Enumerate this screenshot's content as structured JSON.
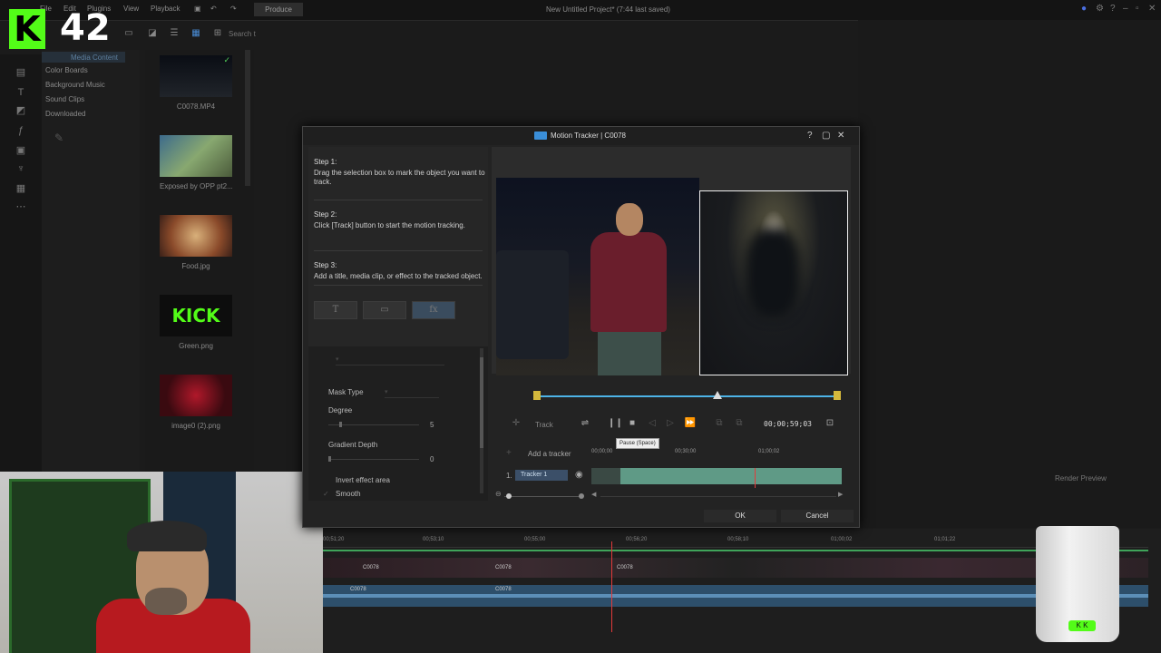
{
  "menubar": {
    "items": [
      "File",
      "Edit",
      "Plugins",
      "View",
      "Playback"
    ],
    "produce_label": "Produce",
    "project_title": "New Untitled Project* (7:44 last saved)"
  },
  "overlay": {
    "kick_badge": "K",
    "kick_count": "42"
  },
  "media_toolbar": {
    "search_placeholder": "Search t"
  },
  "library_tree": {
    "items": [
      "Media Content",
      "Color Boards",
      "Background Music",
      "Sound Clips",
      "Downloaded"
    ]
  },
  "media_items": [
    {
      "label": "C0078.MP4"
    },
    {
      "label": "Exposed by OPP pt2...."
    },
    {
      "label": "Food.jpg"
    },
    {
      "label": "Green.png",
      "thumb_text": "KICK"
    },
    {
      "label": "image0 (2).png"
    }
  ],
  "dialog": {
    "title": "Motion Tracker | C0078",
    "step1_title": "Step 1:",
    "step1_text": "Drag the selection box to mark the object you want to track.",
    "step2_title": "Step 2:",
    "step2_text": "Click [Track] button to start the motion tracking.",
    "step3_title": "Step 3:",
    "step3_text": "Add a title, media clip, or effect to the tracked object.",
    "tool_title": "T",
    "tool_fx": "fx",
    "props": {
      "mask_type_label": "Mask Type",
      "degree_label": "Degree",
      "degree_value": "5",
      "gradient_label": "Gradient Depth",
      "gradient_value": "0",
      "invert_label": "Invert effect area",
      "smooth_label": "Smooth"
    },
    "track_label": "Track",
    "timecode": "00;00;59;03",
    "tooltip": "Pause (Space)",
    "add_tracker_label": "Add a tracker",
    "ruler": [
      "00;00;00",
      "00;30;00",
      "01;00;02"
    ],
    "tracker_number": "1.",
    "tracker_name": "Tracker 1",
    "ok_label": "OK",
    "cancel_label": "Cancel"
  },
  "render_preview": "Render Preview",
  "timeline": {
    "ticks": [
      "00;51;20",
      "00;53;10",
      "00;55;00",
      "00;56;20",
      "00;58;10",
      "01;00;02",
      "01;01;22"
    ],
    "clip_label": "C0078"
  },
  "cup_logo": "K K",
  "colors": {
    "accent": "#4db3e6",
    "kick_green": "#53fc18",
    "tracker_clip": "#5f9a86"
  }
}
